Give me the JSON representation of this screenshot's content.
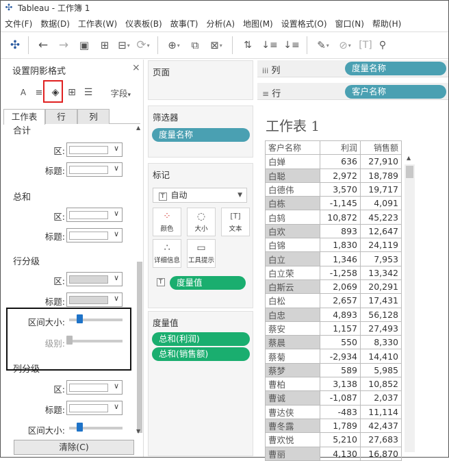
{
  "window": {
    "title": "Tableau - 工作簿 1"
  },
  "menu": [
    "文件(F)",
    "数据(D)",
    "工作表(W)",
    "仪表板(B)",
    "故事(T)",
    "分析(A)",
    "地图(M)",
    "设置格式(O)",
    "窗口(N)",
    "帮助(H)"
  ],
  "format_pane": {
    "title": "设置阴影格式",
    "close": "×",
    "fields_label": "字段",
    "tabs": [
      "工作表",
      "行",
      "列"
    ],
    "sections": {
      "heji": "合计",
      "zonghe": "总和",
      "row_band": "行分级",
      "col_band": "列分级"
    },
    "labels": {
      "area": "区:",
      "header": "标题:",
      "band_size": "区间大小:",
      "level": "级别:"
    },
    "clear_button": "清除(C)"
  },
  "cards": {
    "pages": "页面",
    "filters": "筛选器",
    "filter_pill": "度量名称",
    "marks": "标记",
    "mark_type": "自动",
    "mark_buttons": [
      "颜色",
      "大小",
      "文本",
      "详细信息",
      "工具提示"
    ],
    "measure_values_pill": "度量值",
    "measure_values": "度量值",
    "measures": [
      "总和(利润)",
      "总和(销售额)"
    ]
  },
  "shelves": {
    "columns_label": "列",
    "rows_label": "行",
    "columns_pill": "度量名称",
    "rows_pill": "客户名称"
  },
  "sheet": {
    "title": "工作表 1",
    "headers": [
      "客户名称",
      "利润",
      "销售额"
    ],
    "rows": [
      [
        "白婵",
        "636",
        "27,910"
      ],
      [
        "白聪",
        "2,972",
        "18,789"
      ],
      [
        "白德伟",
        "3,570",
        "19,717"
      ],
      [
        "白栋",
        "-1,145",
        "4,091"
      ],
      [
        "白鸫",
        "10,872",
        "45,223"
      ],
      [
        "白欢",
        "893",
        "12,647"
      ],
      [
        "白锦",
        "1,830",
        "24,119"
      ],
      [
        "白立",
        "1,346",
        "7,953"
      ],
      [
        "白立荣",
        "-1,258",
        "13,342"
      ],
      [
        "白斯云",
        "2,069",
        "20,291"
      ],
      [
        "白松",
        "2,657",
        "17,431"
      ],
      [
        "白忠",
        "4,893",
        "56,128"
      ],
      [
        "蔡安",
        "1,157",
        "27,493"
      ],
      [
        "蔡晨",
        "550",
        "8,330"
      ],
      [
        "蔡菊",
        "-2,934",
        "14,410"
      ],
      [
        "蔡梦",
        "589",
        "5,985"
      ],
      [
        "曹柏",
        "3,138",
        "10,852"
      ],
      [
        "曹诚",
        "-1,087",
        "2,037"
      ],
      [
        "曹达侠",
        "-483",
        "11,114"
      ],
      [
        "曹冬露",
        "1,789",
        "42,437"
      ],
      [
        "曹欢悦",
        "5,210",
        "27,683"
      ],
      [
        "曹丽",
        "4,130",
        "16,870"
      ]
    ]
  }
}
